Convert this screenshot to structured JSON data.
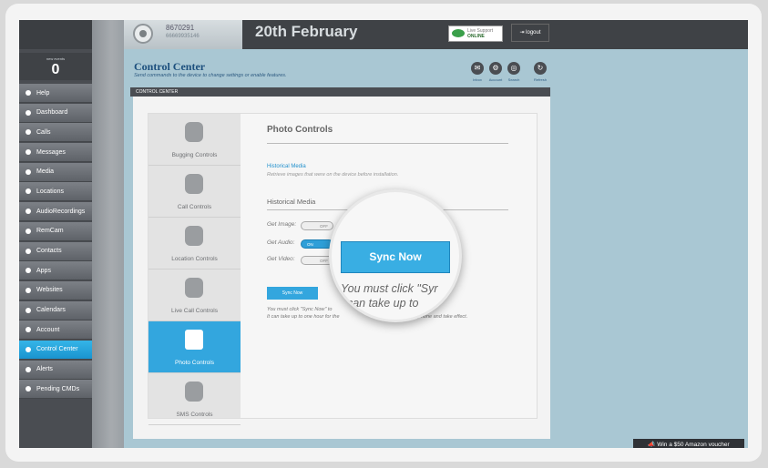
{
  "sidebar": {
    "events_label": "new events",
    "events_count": "0",
    "items": [
      {
        "label": "Help"
      },
      {
        "label": "Dashboard"
      },
      {
        "label": "Calls"
      },
      {
        "label": "Messages"
      },
      {
        "label": "Media"
      },
      {
        "label": "Locations"
      },
      {
        "label": "AudioRecordings"
      },
      {
        "label": "RemCam"
      },
      {
        "label": "Contacts"
      },
      {
        "label": "Apps"
      },
      {
        "label": "Websites"
      },
      {
        "label": "Calendars"
      },
      {
        "label": "Account"
      },
      {
        "label": "Control Center"
      },
      {
        "label": "Alerts"
      },
      {
        "label": "Pending CMDs"
      }
    ],
    "active_item": "Control Center"
  },
  "header": {
    "device_id": "8670291",
    "device_sub": "66669935146",
    "date": "20th February",
    "live_support_label": "Live Support",
    "live_support_status": "ONLINE",
    "logout_label": "logout"
  },
  "content": {
    "title": "Control Center",
    "subtitle": "Send commands to the device to change settings or enable features.",
    "toolbar": [
      {
        "label": "Inbox",
        "icon": "inbox-icon"
      },
      {
        "label": "Account",
        "icon": "gear-icon"
      },
      {
        "label": "Search",
        "icon": "search-icon"
      },
      {
        "label": "Refresh",
        "icon": "refresh-icon"
      }
    ],
    "bar_label": "CONTROL CENTER",
    "tabs": [
      {
        "label": "Bugging Controls",
        "icon": "microphone-icon"
      },
      {
        "label": "Call Controls",
        "icon": "phone-icon"
      },
      {
        "label": "Location Controls",
        "icon": "map-pin-icon"
      },
      {
        "label": "Live Call Controls",
        "icon": "eye-icon"
      },
      {
        "label": "Photo Controls",
        "icon": "camera-icon"
      },
      {
        "label": "SMS Controls",
        "icon": "speech-bubble-icon"
      }
    ],
    "active_tab": "Photo Controls",
    "panel": {
      "heading": "Photo Controls",
      "historical_link": "Historical Media",
      "historical_desc": "Retrieve images that were on the device before installation.",
      "historical_heading": "Historical Media",
      "rows": [
        {
          "label": "Get Image:",
          "state": "OFF"
        },
        {
          "label": "Get Audio:",
          "state": "ON"
        },
        {
          "label": "Get Video:",
          "state": "OFF"
        }
      ],
      "sync_small": "Sync Now",
      "note_line1": "You must click \"Sync Now\" to",
      "note_line2": "It can take up to one hour for the",
      "note_tail": "the target phone and take effect.",
      "magnified_sync": "Sync Now",
      "magnified_line1": "You must click \"Syr",
      "magnified_line2": "t can take up to"
    }
  },
  "footer": {
    "voucher": "Win a $50 Amazon voucher"
  },
  "colors": {
    "accent": "#33a6de",
    "sidebar": "#4a4d52",
    "background": "#a9c7d3"
  }
}
